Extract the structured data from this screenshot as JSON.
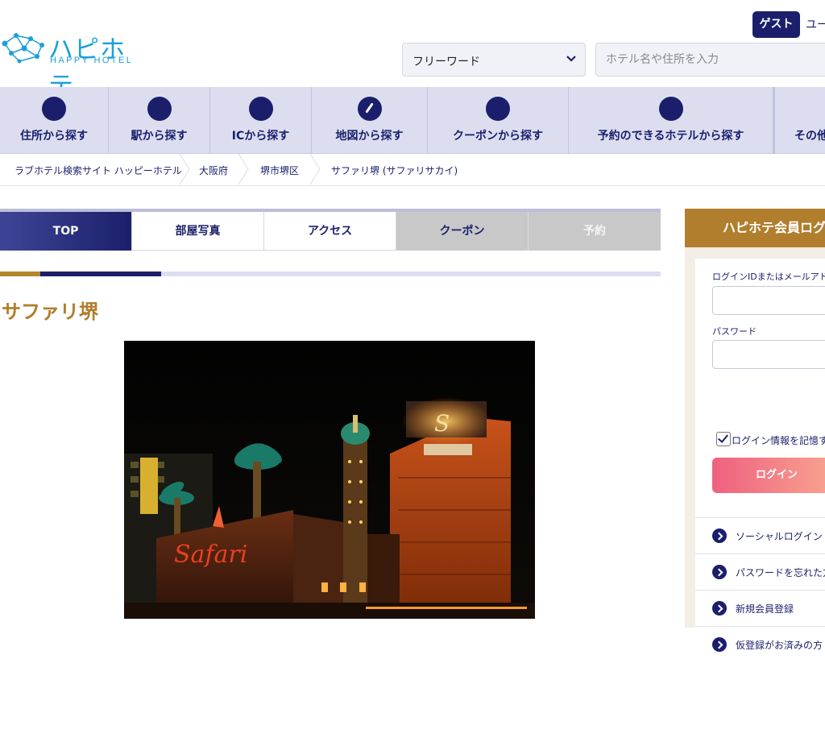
{
  "header": {
    "logo_jp": "ハピホテ",
    "logo_en": "HAPPY HOTEL",
    "guest_label": "ゲスト",
    "user_label": "ユー",
    "search_select_value": "フリーワード",
    "search_placeholder": "ホテル名や住所を入力"
  },
  "nav": {
    "items": [
      {
        "label": "住所から探す",
        "icon": "circle-icon"
      },
      {
        "label": "駅から探す",
        "icon": "circle-icon"
      },
      {
        "label": "ICから探す",
        "icon": "circle-icon"
      },
      {
        "label": "地図から探す",
        "icon": "map-icon"
      },
      {
        "label": "クーポンから探す",
        "icon": "circle-icon"
      },
      {
        "label": "予約のできるホテルから探す",
        "icon": "circle-icon"
      },
      {
        "label": "その他",
        "icon": "circle-icon"
      }
    ]
  },
  "breadcrumb": {
    "items": [
      "ラブホテル検索サイト ハッピーホテル",
      "大阪府",
      "堺市堺区",
      "サファリ堺 (サファリサカイ)"
    ]
  },
  "tabs": {
    "items": [
      {
        "label": "TOP",
        "state": "active"
      },
      {
        "label": "部屋写真",
        "state": "normal"
      },
      {
        "label": "アクセス",
        "state": "normal"
      },
      {
        "label": "クーポン",
        "state": "disabled"
      },
      {
        "label": "予約",
        "state": "disabled"
      }
    ]
  },
  "hotel": {
    "title": "サファリ堺"
  },
  "login": {
    "header": "ハピホテ会員ログ",
    "id_label": "ログインIDまたはメールアドレ",
    "password_label": "パスワード",
    "remember_label": "ログイン情報を記憶す",
    "remember_checked": true,
    "login_button": "ログイン",
    "links": [
      "ソーシャルログイン",
      "パスワードを忘れた方",
      "新規会員登録",
      "仮登録がお済みの方"
    ]
  },
  "colors": {
    "navy": "#1b1f6b",
    "gold": "#b07e2c",
    "nav_bg": "#dcdef0",
    "logo_blue": "#1ba0d8"
  }
}
